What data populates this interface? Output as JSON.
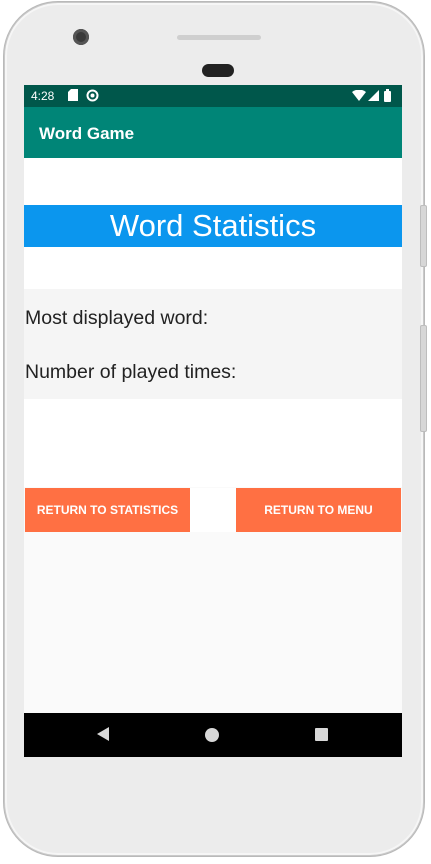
{
  "status_bar": {
    "time": "4:28",
    "icons": [
      "sd-card-icon",
      "sync-icon",
      "wifi-icon",
      "signal-icon",
      "battery-icon"
    ],
    "background_color": "#00574b"
  },
  "app_bar": {
    "title": "Word Game",
    "background_color": "#008577"
  },
  "statistics": {
    "header": "Word Statistics",
    "header_color": "#0b96ee",
    "most_displayed_label": "Most displayed word:",
    "played_times_label": "Number of played times:"
  },
  "buttons": {
    "return_to_statistics": "RETURN TO STATISTICS",
    "return_to_menu": "RETURN TO MENU",
    "color": "#ff7043"
  },
  "nav_bar": {
    "icons": [
      "back-icon",
      "home-icon",
      "recents-icon"
    ]
  }
}
